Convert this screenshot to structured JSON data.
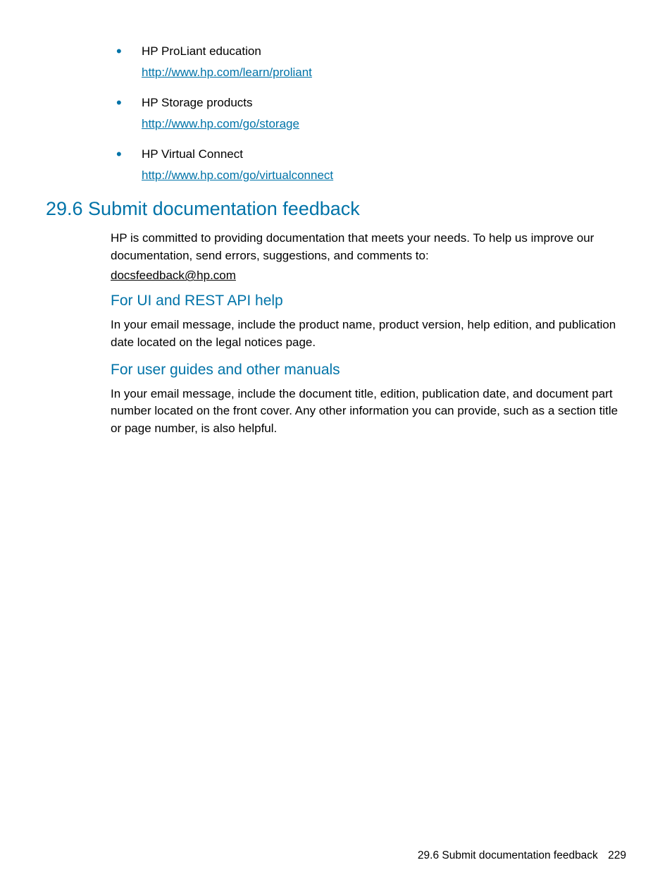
{
  "bullets": [
    {
      "text": "HP ProLiant education",
      "link": "http://www.hp.com/learn/proliant"
    },
    {
      "text": "HP Storage products",
      "link": "http://www.hp.com/go/storage"
    },
    {
      "text": "HP Virtual Connect",
      "link": "http://www.hp.com/go/virtualconnect"
    }
  ],
  "section": {
    "heading": "29.6 Submit documentation feedback",
    "intro": "HP is committed to providing documentation that meets your needs. To help us improve our documentation, send errors, suggestions, and comments to:",
    "email": "docsfeedback@hp.com",
    "sub1": {
      "heading": "For UI and REST API help",
      "body": "In your email message, include the product name, product version, help edition, and publication date located on the legal notices page."
    },
    "sub2": {
      "heading": "For user guides and other manuals",
      "body": "In your email message, include the document title, edition, publication date, and document part number located on the front cover. Any other information you can provide, such as a section title or page number, is also helpful."
    }
  },
  "footer": {
    "text": "29.6 Submit documentation feedback",
    "page": "229"
  }
}
